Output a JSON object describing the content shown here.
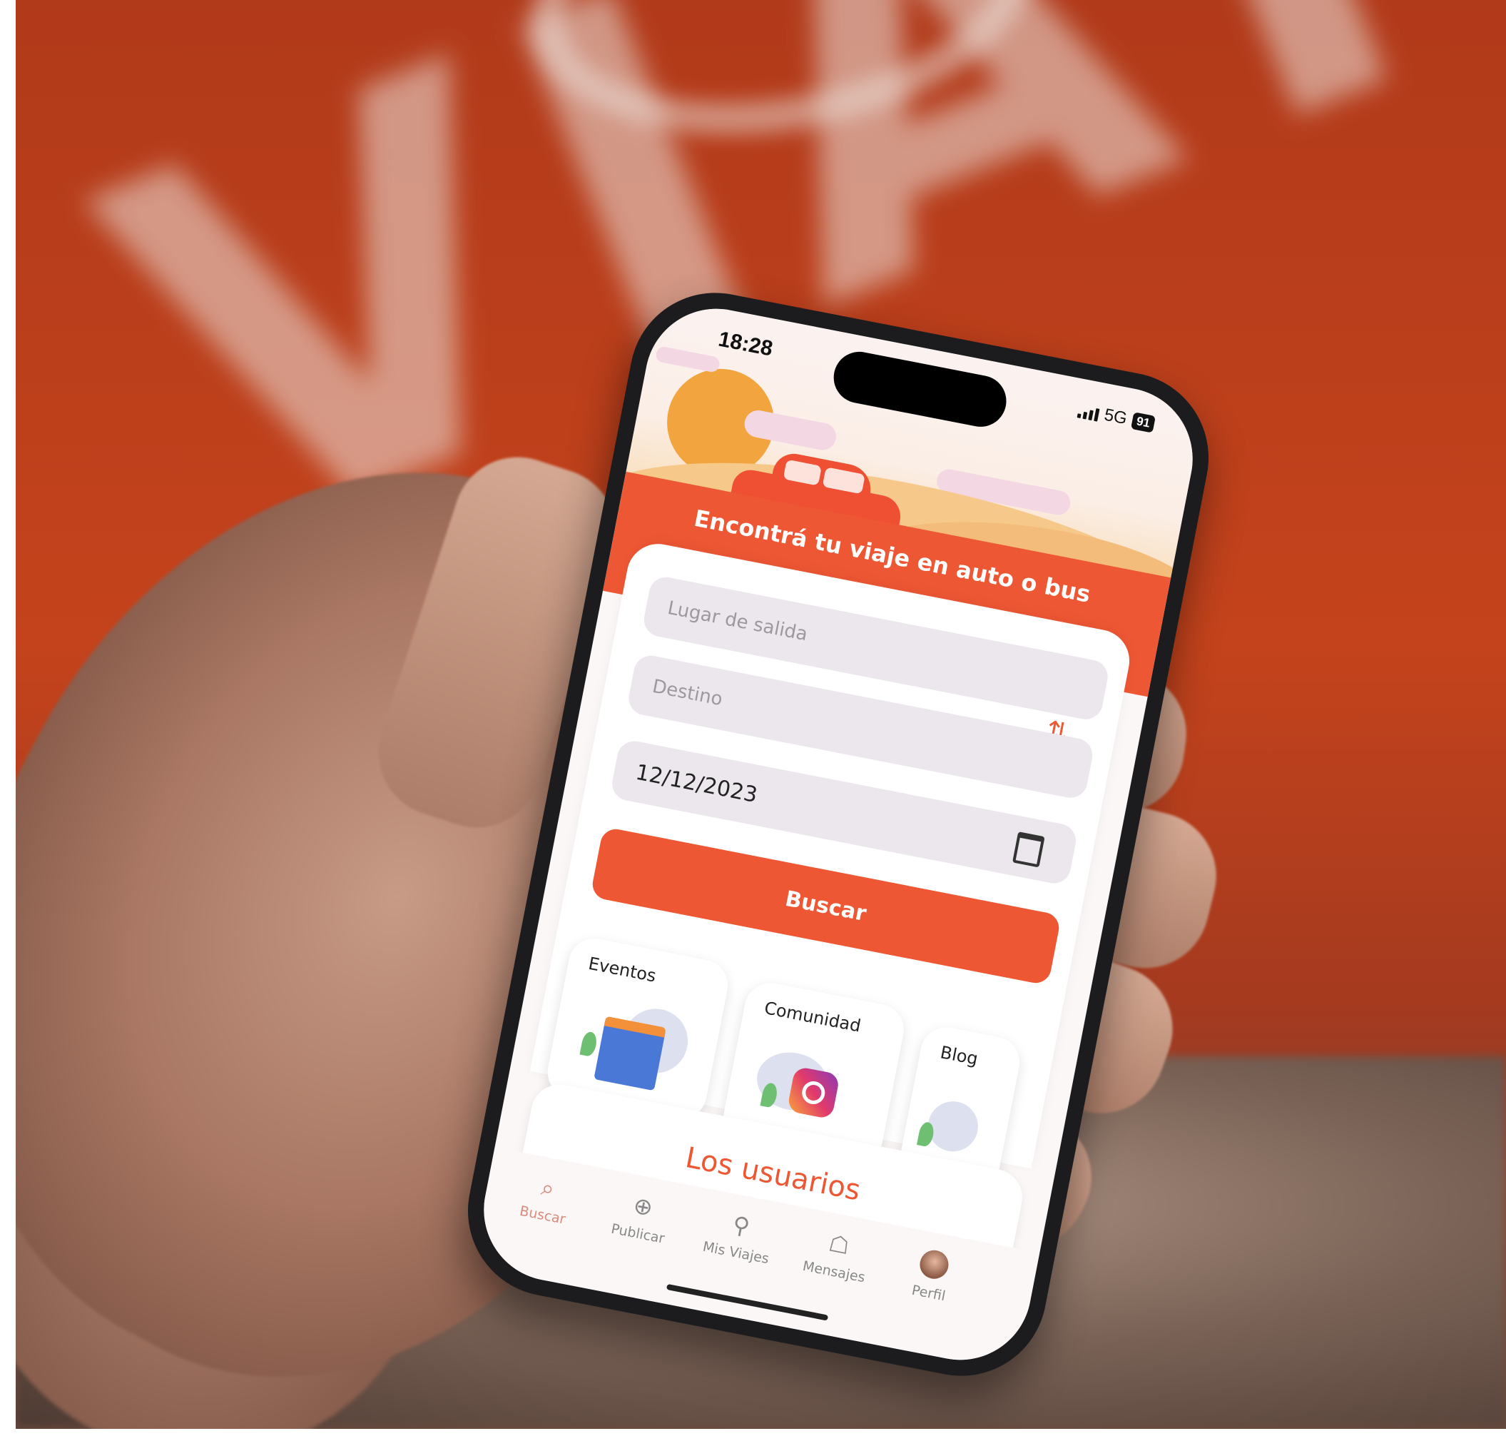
{
  "background": {
    "banner_text": "VIATIK",
    "banner_color": "#c4431c"
  },
  "status_bar": {
    "time": "18:28",
    "network": "5G",
    "battery": "91"
  },
  "app": {
    "accent": "#ee5733",
    "hero_title": "Encontrá tu viaje en auto o bus",
    "search_form": {
      "origin_placeholder": "Lugar de salida",
      "destination_placeholder": "Destino",
      "date_value": "12/12/2023",
      "swap_icon": "swap-arrows-icon",
      "calendar_icon": "calendar-icon",
      "search_button": "Buscar"
    },
    "tiles": [
      {
        "label": "Eventos",
        "icon": "calendar-illustration"
      },
      {
        "label": "Comunidad",
        "icon": "instagram-illustration"
      },
      {
        "label": "Blog",
        "icon": "blog-illustration"
      }
    ],
    "users_section_title": "Los usuarios",
    "tab_bar": [
      {
        "label": "Buscar",
        "icon": "search-icon",
        "active": true
      },
      {
        "label": "Publicar",
        "icon": "plus-circle-icon",
        "active": false
      },
      {
        "label": "Mis Viajes",
        "icon": "location-pin-icon",
        "active": false
      },
      {
        "label": "Mensajes",
        "icon": "chat-bubbles-icon",
        "active": false
      },
      {
        "label": "Perfil",
        "icon": "avatar-icon",
        "active": false
      }
    ]
  }
}
